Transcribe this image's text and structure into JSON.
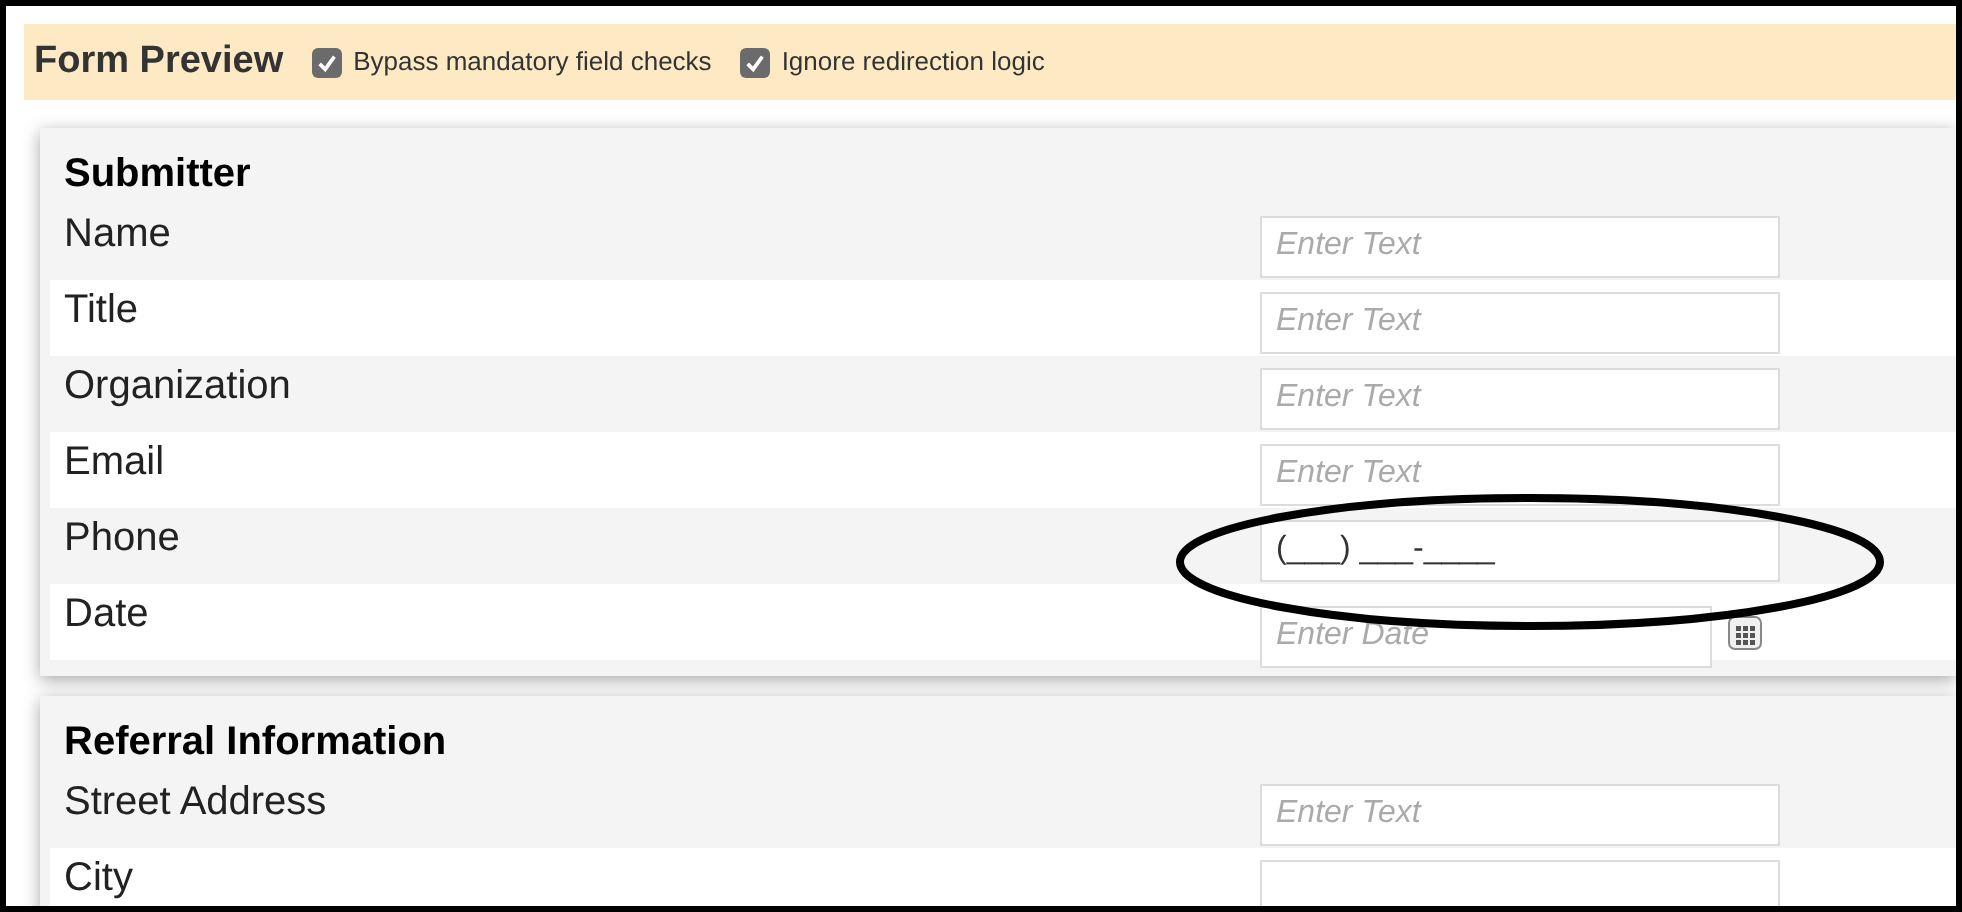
{
  "header": {
    "title": "Form Preview",
    "options": [
      {
        "label": "Bypass mandatory field checks",
        "checked": true
      },
      {
        "label": "Ignore redirection logic",
        "checked": true
      }
    ]
  },
  "sections": [
    {
      "title": "Submitter",
      "fields": [
        {
          "label": "Name",
          "kind": "text",
          "placeholder": "Enter Text"
        },
        {
          "label": "Title",
          "kind": "text",
          "placeholder": "Enter Text"
        },
        {
          "label": "Organization",
          "kind": "text",
          "placeholder": "Enter Text"
        },
        {
          "label": "Email",
          "kind": "text",
          "placeholder": "Enter Text"
        },
        {
          "label": "Phone",
          "kind": "text",
          "value": "(___) ___-____"
        },
        {
          "label": "Date",
          "kind": "date",
          "placeholder": "Enter Date"
        }
      ]
    },
    {
      "title": "Referral Information",
      "fields": [
        {
          "label": "Street Address",
          "kind": "text",
          "placeholder": "Enter Text"
        },
        {
          "label": "City",
          "kind": "text"
        }
      ]
    }
  ]
}
